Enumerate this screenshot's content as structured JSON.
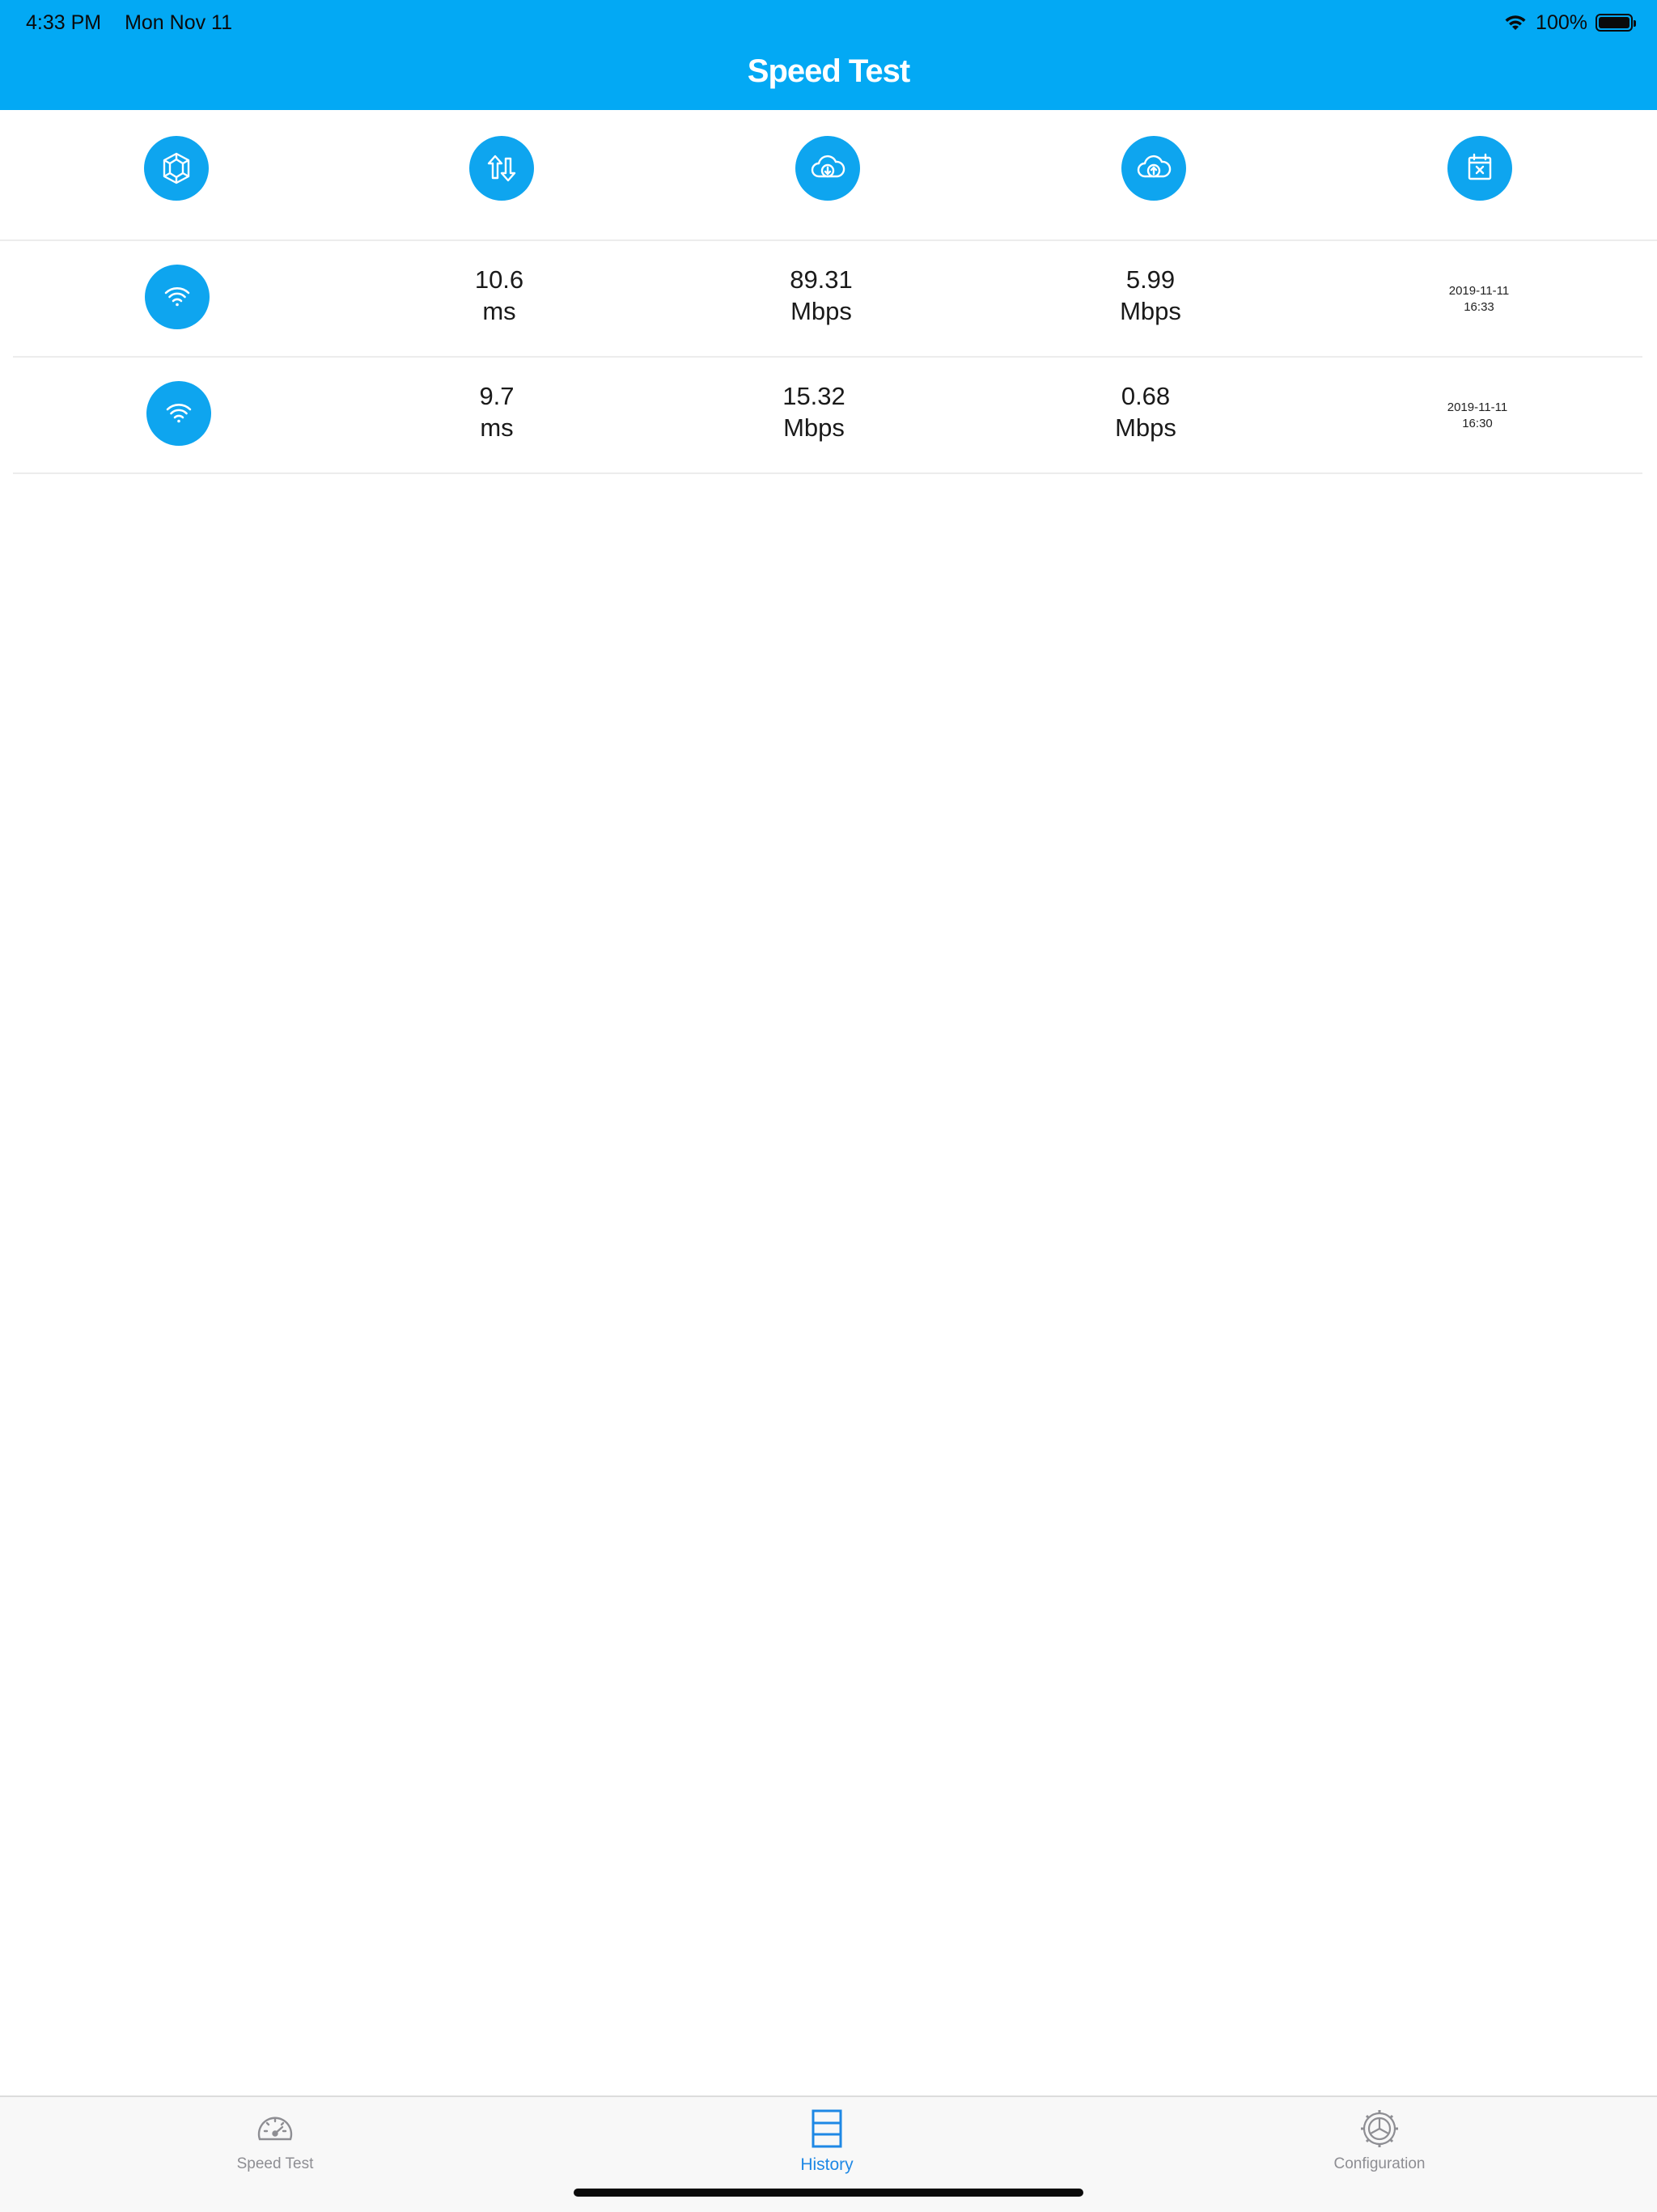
{
  "status_bar": {
    "time": "4:33 PM",
    "date": "Mon Nov 11",
    "battery": "100%"
  },
  "nav": {
    "title": "Speed Test"
  },
  "columns": [
    {
      "icon": "server-icon"
    },
    {
      "icon": "ping-arrows-icon"
    },
    {
      "icon": "cloud-download-icon"
    },
    {
      "icon": "cloud-upload-icon"
    },
    {
      "icon": "calendar-delete-icon"
    }
  ],
  "history": [
    {
      "connection_icon": "wifi-icon",
      "ping": "10.6",
      "ping_unit": "ms",
      "download": "89.31",
      "download_unit": "Mbps",
      "upload": "5.99",
      "upload_unit": "Mbps",
      "date": "2019-11-11",
      "time": "16:33"
    },
    {
      "connection_icon": "wifi-icon",
      "ping": "9.7",
      "ping_unit": "ms",
      "download": "15.32",
      "download_unit": "Mbps",
      "upload": "0.68",
      "upload_unit": "Mbps",
      "date": "2019-11-11",
      "time": "16:30"
    }
  ],
  "tabbar": {
    "tabs": [
      {
        "label": "Speed Test",
        "icon": "speedometer-icon",
        "active": false
      },
      {
        "label": "History",
        "icon": "history-icon",
        "active": true
      },
      {
        "label": "Configuration",
        "icon": "gear-icon",
        "active": false
      }
    ]
  },
  "colors": {
    "accent": "#03a9f4",
    "icon_circle": "#0ea5ef",
    "active_tab": "#1e88e5",
    "inactive_tab": "#8e8e93"
  }
}
